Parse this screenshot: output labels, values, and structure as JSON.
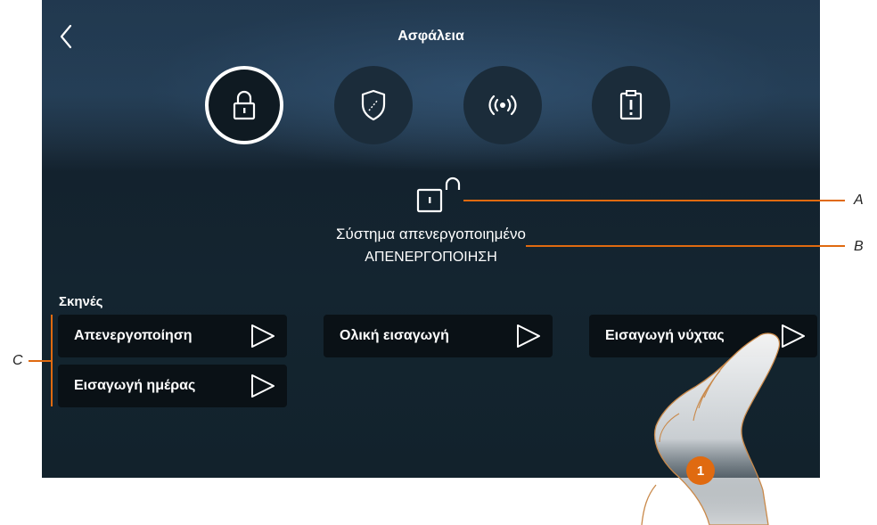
{
  "header": {
    "title": "Ασφάλεια"
  },
  "tabs": [
    {
      "name": "lock",
      "active": true
    },
    {
      "name": "shield",
      "active": false
    },
    {
      "name": "radio",
      "active": false
    },
    {
      "name": "clipboard-alert",
      "active": false
    }
  ],
  "status": {
    "text": "Σύστημα απενεργοποιημένο",
    "mode": "ΑΠΕΝΕΡΓΟΠΟΙΗΣΗ"
  },
  "scenes": {
    "label": "Σκηνές",
    "items": [
      {
        "label": "Απενεργοποίηση"
      },
      {
        "label": "Ολική εισαγωγή"
      },
      {
        "label": "Εισαγωγή νύχτας"
      },
      {
        "label": "Εισαγωγή ημέρας"
      }
    ]
  },
  "callouts": {
    "a": "A",
    "b": "B",
    "c": "C"
  },
  "step": {
    "number": "1"
  },
  "colors": {
    "accent": "#e06a10",
    "background": "#142530",
    "button": "#0a1116"
  }
}
